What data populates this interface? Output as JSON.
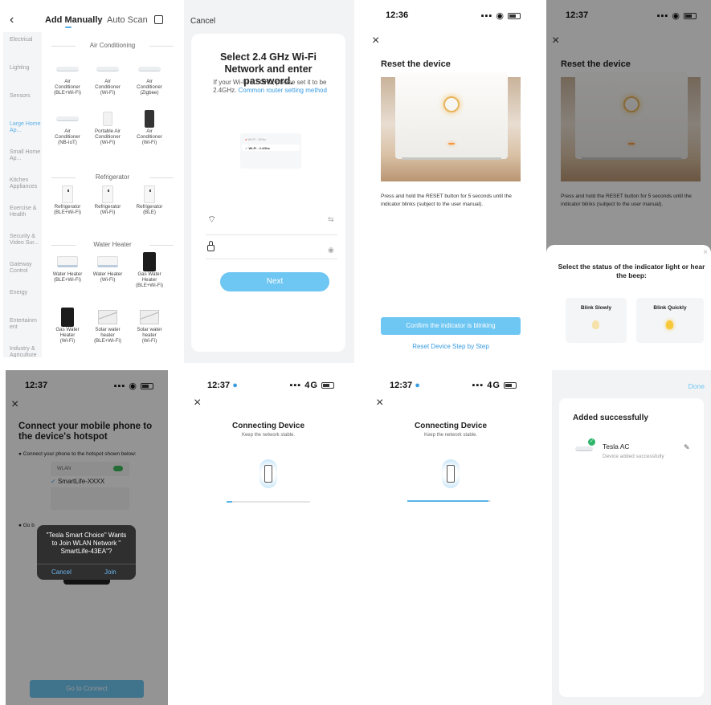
{
  "p1": {
    "tabs": [
      "Add Manually",
      "Auto Scan"
    ],
    "categories": [
      "Electrical",
      "Lighting",
      "Sensors",
      "Large Home Ap...",
      "Small Home Ap...",
      "Kitchen Appliances",
      "Exercise & Health",
      "Security & Video Sur...",
      "Gateway Control",
      "Energy",
      "Entertainm ent",
      "Industry & Agriculture"
    ],
    "groups": [
      "Air Conditioning",
      "Refrigerator",
      "Water Heater"
    ],
    "devices": [
      [
        "Air",
        "Conditioner",
        "(BLE+Wi-Fi)"
      ],
      [
        "Air",
        "Conditioner",
        "(Wi-Fi)"
      ],
      [
        "Air",
        "Conditioner",
        "(Zigbee)"
      ],
      [
        "Air",
        "Conditioner",
        "(NB-IoT)"
      ],
      [
        "Portable Air",
        "Conditioner",
        "(Wi-Fi)"
      ],
      [
        "Air",
        "Conditioner",
        "(Wi-Fi)"
      ],
      [
        "Refrigerator",
        "(BLE+Wi-Fi)",
        ""
      ],
      [
        "Refrigerator",
        "(Wi-Fi)",
        ""
      ],
      [
        "Refrigerator",
        "(BLE)",
        ""
      ],
      [
        "Water Heater",
        "(BLE+Wi-Fi)",
        ""
      ],
      [
        "Water Heater",
        "(Wi-Fi)",
        ""
      ],
      [
        "Gas Water",
        "Heater",
        "(BLE+Wi-Fi)"
      ],
      [
        "Gas Water",
        "Heater",
        "(Wi-Fi)"
      ],
      [
        "Solar water",
        "heater",
        "(BLE+Wi-Fi)"
      ],
      [
        "Solar water",
        "heater",
        "(Wi-Fi)"
      ]
    ]
  },
  "p2": {
    "cancel": "Cancel",
    "title": "Select 2.4 GHz Wi-Fi Network and enter password.",
    "desc": "If your Wi-Fi is 5GHz, please set it to be 2.4GHz.",
    "link": "Common router setting method",
    "wifi_row1": "Wi-Fi - 5Ghz",
    "wifi_row2": "Wi-Fi - 2.4Ghz",
    "next": "Next"
  },
  "p3": {
    "time": "12:36",
    "title": "Reset the device",
    "instr": "Press and hold the RESET button for 5 seconds until the indicator blinks (subject to the user manual).",
    "confirm": "Confirm the indicator is blinking",
    "step": "Reset Device Step by Step"
  },
  "p4": {
    "time": "12:37",
    "title": "Reset the device",
    "instr": "Press and hold the RESET button for 5 seconds until the indicator blinks (subject to the user manual).",
    "sheet_title": "Select the status of the indicator light or hear the beep:",
    "slow": "Blink Slowly",
    "quick": "Blink Quickly"
  },
  "p5": {
    "time": "12:37",
    "title": "Connect your mobile phone to the device's hotspot",
    "step1": "Connect your phone to the hotspot shown below:",
    "wlan": "WLAN",
    "ssid": "SmartLife-XXXX",
    "step2": "Go b",
    "alert": "\"Tesla Smart Choice\" Wants to Join WLAN Network \" SmartLife-43EA\"?",
    "cancel": "Cancel",
    "join": "Join",
    "go": "Go to Connect"
  },
  "p6": {
    "time": "12:37",
    "net": "4G",
    "title": "Connecting Device",
    "sub": "Keep the network stable.",
    "progress": 0.07
  },
  "p7": {
    "time": "12:37",
    "net": "4G",
    "title": "Connecting Device",
    "sub": "Keep the network stable.",
    "progress": 0.97
  },
  "p8": {
    "done": "Done",
    "title": "Added successfully",
    "name": "Tesla AC",
    "status": "Device added successfully"
  },
  "colors": {
    "accent": "#6ec6f2",
    "link": "#3a9be0",
    "success": "#2db56a"
  }
}
